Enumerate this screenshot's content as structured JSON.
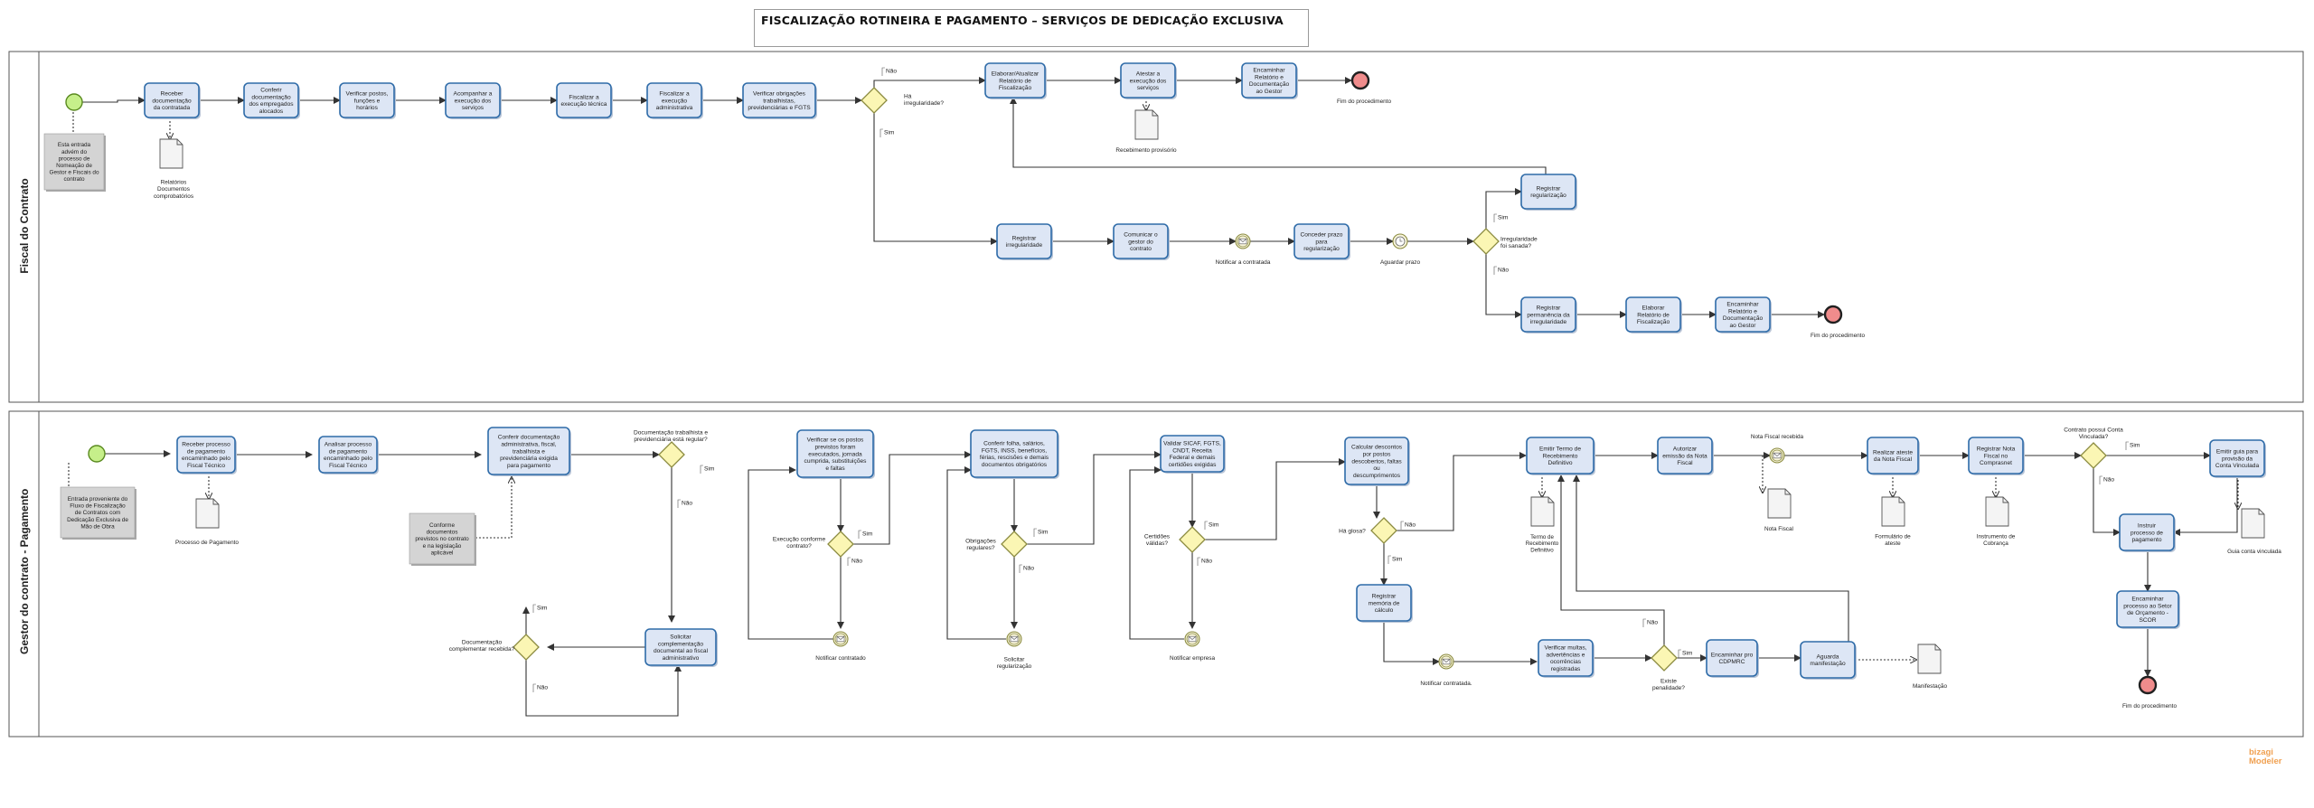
{
  "title": "FISCALIZAÇÃO ROTINEIRA E PAGAMENTO – SERVIÇOS DE DEDICAÇÃO EXCLUSIVA",
  "lanes": {
    "fiscal": "Fiscal do Contrato",
    "gestor": "Gestor do contrato - Pagamento"
  },
  "watermark": {
    "line1": "bizagi",
    "line2": "Modeler"
  },
  "colors": {
    "task_fill": "#dde6f5",
    "task_border": "#2e6ba8",
    "start_fill": "#c6ef8a",
    "end_fill": "#f08c8c",
    "gateway_fill": "#fbf6b4",
    "annotation_fill": "#d4d4d4",
    "line": "#333333"
  },
  "fiscal": {
    "tasks": [
      [
        "Receber",
        "documentação",
        "da contratada"
      ],
      [
        "Conferir",
        "documentação",
        "dos empregados",
        "alocados"
      ],
      [
        "Verificar postos,",
        "funções e",
        "horários"
      ],
      [
        "Acompanhar a",
        "execução dos",
        "serviços"
      ],
      [
        "Fiscalizar a",
        "execução técnica"
      ],
      [
        "Fiscalizar a",
        "execução",
        "administrativa"
      ],
      [
        "Verificar obrigações",
        "trabalhistas,",
        "previdenciárias e FGTS"
      ],
      [
        "Elaborar/Atualizar",
        "Relatório de",
        "Fiscalização"
      ],
      [
        "Atestar a",
        "execução dos",
        "serviços"
      ],
      [
        "Encaminhar",
        "Relatório e",
        "Documentação",
        "ao Gestor"
      ],
      [
        "Registrar",
        "irregularidade"
      ],
      [
        "Comunicar o",
        "gestor do",
        "contrato"
      ],
      [
        "Conceder prazo",
        "para",
        "regularização"
      ],
      [
        "Registrar",
        "regularização"
      ],
      [
        "Registrar",
        "permanência da",
        "irregularidade"
      ],
      [
        "Elaborar",
        "Relatório de",
        "Fiscalização"
      ],
      [
        "Encaminhar",
        "Relatório e",
        "Documentação",
        "ao Gestor"
      ]
    ],
    "gateways": [
      [
        "Há",
        "irregularidade?"
      ],
      [
        "Irregularidade",
        "foi sanada?"
      ]
    ],
    "annotation": [
      "Esta entrada",
      "advém do",
      "processo de",
      "Nomeação de",
      "Gestor e Fiscais do",
      "contrato"
    ],
    "docs": [
      [
        "Relatórios",
        "Documentos",
        "comprobatórios"
      ],
      [
        "Recebimento provisório"
      ]
    ],
    "events": [
      "Notificar a contratada",
      "Aguardar prazo"
    ],
    "ends": [
      "Fim do procedimento",
      "Fim do procedimento"
    ],
    "flow_labels": [
      "Não",
      "Sim",
      "Sim",
      "Não"
    ]
  },
  "gestor": {
    "tasks": [
      [
        "Receber processo",
        "de pagamento",
        "encaminhado pelo",
        "Fiscal Técnico"
      ],
      [
        "Analisar processo",
        "de pagamento",
        "encaminhado pelo",
        "Fiscal Técnico"
      ],
      [
        "Conferir documentação",
        "administrativa, fiscal,",
        "trabalhista e",
        "previdenciária exigida",
        "para pagamento"
      ],
      [
        "Solicitar",
        "complementação",
        "documental ao fiscal",
        "administrativo"
      ],
      [
        "Verificar se os postos",
        "previstos foram",
        "executados, jornada",
        "cumprida, substituições",
        "e faltas"
      ],
      [
        "Conferir folha, salários,",
        "FGTS, INSS, benefícios,",
        "férias, rescisões e demais",
        "documentos obrigatórios"
      ],
      [
        "Validar SICAF, FGTS,",
        "CNDT, Receita",
        "Federal e demais",
        "certidões exigidas"
      ],
      [
        "Calcular descontos",
        "por postos",
        "descobertos, faltas",
        "ou",
        "descumprimentos"
      ],
      [
        "Registrar",
        "memória de",
        "cálculo"
      ],
      [
        "Emitir Termo de",
        "Recebimento",
        "Definitivo"
      ],
      [
        "Verificar multas,",
        "advertências e",
        "ocorrências",
        "registradas"
      ],
      [
        "Encaminhar pro",
        "CDPMRC"
      ],
      [
        "Aguarda",
        "manifestação"
      ],
      [
        "Autorizar",
        "emissão da Nota",
        "Fiscal"
      ],
      [
        "Realizar ateste",
        "da Nota Fiscal"
      ],
      [
        "Registrar Nota",
        "Fiscal no",
        "Comprasnet"
      ],
      [
        "Emitir guia para",
        "provisão da",
        "Conta Vinculada"
      ],
      [
        "Instruir",
        "processo de",
        "pagamento"
      ],
      [
        "Encaminhar",
        "processo ao Setor",
        "de Orçamento -",
        "SCOR"
      ]
    ],
    "gateways": [
      [
        "Documentação trabalhista e",
        "previdenciária está regular?"
      ],
      [
        "Documentação",
        "complementar recebida?"
      ],
      [
        "Execução conforme",
        "contrato?"
      ],
      [
        "Obrigações",
        "regulares?"
      ],
      [
        "Certidões",
        "válidas?"
      ],
      [
        "Há glosa?"
      ],
      [
        "Existe",
        "penalidade?"
      ],
      [
        "Contrato possui Conta",
        "Vinculada?"
      ]
    ],
    "annotations": [
      [
        "Entrada proveniente do",
        "Fluxo de Fiscalização",
        "de Contratos com",
        "Dedicação Exclusiva de",
        "Mão de Obra"
      ],
      [
        "Conforme",
        "documentos",
        "previstos no contrato",
        "e na legislação",
        "aplicável"
      ]
    ],
    "docs": [
      [
        "Processo de Pagamento"
      ],
      [
        "Termo de",
        "Recebimento",
        "Definitivo"
      ],
      [
        "Nota Fiscal"
      ],
      [
        "Formulário de",
        "ateste"
      ],
      [
        "Instrumento de",
        "Cobrança"
      ],
      [
        "Guia conta vinculada"
      ],
      [
        "Manifestação"
      ]
    ],
    "events": [
      [
        "Notificar contratado"
      ],
      [
        "Solicitar",
        "regularização"
      ],
      [
        "Notificar empresa"
      ],
      [
        "Notificar contratada."
      ],
      [
        "Nota Fiscal recebida"
      ]
    ],
    "end": [
      "Fim do procedimento"
    ],
    "flow_labels": {
      "sim": "Sim",
      "nao": "Não"
    }
  }
}
